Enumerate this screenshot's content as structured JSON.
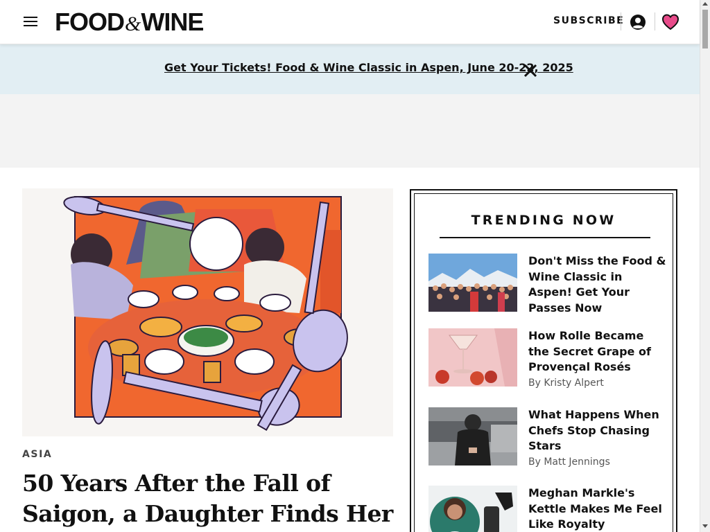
{
  "header": {
    "logo_food": "FOOD",
    "logo_amp": "&",
    "logo_wine": "WINE",
    "subscribe": "SUBSCRIBE"
  },
  "banner": {
    "text": "Get Your Tickets! Food & Wine Classic in Aspen, June 20-22, 2025"
  },
  "hero": {
    "category": "ASIA",
    "title": "50 Years After the Fall of Saigon, a Daughter Finds Her"
  },
  "trending": {
    "heading": "TRENDING NOW",
    "items": [
      {
        "title": "Don't Miss the Food & Wine Classic in Aspen! Get Your Passes Now",
        "byline": ""
      },
      {
        "title": "How Rolle Became the Secret Grape of Provençal Rosés",
        "byline": "By Kristy Alpert"
      },
      {
        "title": "What Happens When Chefs Stop Chasing Stars",
        "byline": "By Matt Jennings"
      },
      {
        "title": "Meghan Markle's Kettle Makes Me Feel Like Royalty",
        "byline": ""
      }
    ]
  },
  "colors": {
    "banner_bg": "#e2eef3",
    "heart": "#e84b8a",
    "ad_bg": "#f3f3f3"
  }
}
